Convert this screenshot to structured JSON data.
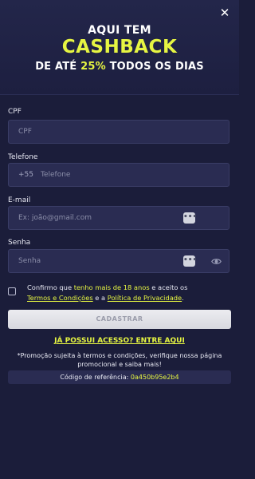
{
  "banner": {
    "line1": "AQUI TEM",
    "line2": "CASHBACK",
    "line3_pre": "DE ATÉ ",
    "line3_pct": "25%",
    "line3_post": " TODOS OS DIAS"
  },
  "close_icon": "close-icon",
  "form": {
    "cpf": {
      "label": "CPF",
      "placeholder": "CPF"
    },
    "phone": {
      "label": "Telefone",
      "prefix": "+55",
      "placeholder": "Telefone"
    },
    "email": {
      "label": "E-mail",
      "placeholder": "Ex: joão@gmail.com"
    },
    "password": {
      "label": "Senha",
      "placeholder": "Senha"
    }
  },
  "consent": {
    "pre": "Confirmo que ",
    "age": "tenho mais de 18 anos",
    "mid": " e aceito os ",
    "terms": "Termos e Condições",
    "and": " e a ",
    "privacy": "Política de Privacidade",
    "end": "."
  },
  "submit_label": "CADASTRAR",
  "login_link": "JÁ POSSUI ACESSO? ENTRE AQUI",
  "promo_text": "*Promoção sujeita à termos e condições, verifique nossa página promocional e saiba mais!",
  "referral": {
    "label": "Código de referência: ",
    "code": "0a450b95e2b4"
  },
  "colors": {
    "accent": "#e6f542",
    "background": "#1b1d3a",
    "field": "#2a2c52"
  }
}
